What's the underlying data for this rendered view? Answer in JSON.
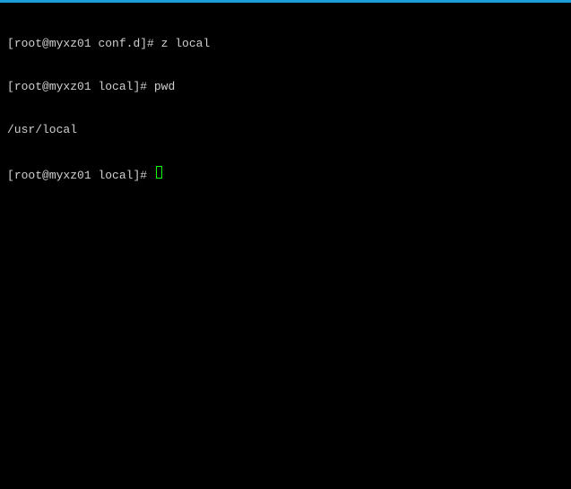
{
  "terminal": {
    "lines": [
      {
        "prompt_open": "[",
        "user_host": "root@myxz01",
        "dir": " conf.d",
        "prompt_close": "]# ",
        "command": "z local"
      },
      {
        "prompt_open": "[",
        "user_host": "root@myxz01",
        "dir": " local",
        "prompt_close": "]# ",
        "command": "pwd"
      },
      {
        "output": "/usr/local"
      },
      {
        "prompt_open": "[",
        "user_host": "root@myxz01",
        "dir": " local",
        "prompt_close": "]# ",
        "command": ""
      }
    ]
  }
}
